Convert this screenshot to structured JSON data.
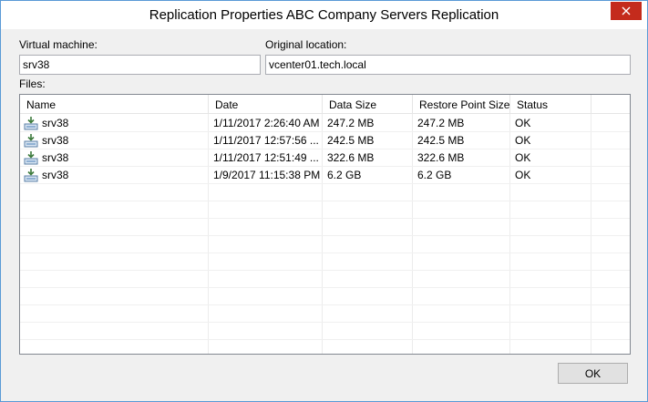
{
  "window": {
    "title": "Replication Properties ABC Company Servers Replication",
    "close_icon": "close-icon"
  },
  "form": {
    "vm_label": "Virtual machine:",
    "vm_value": "srv38",
    "location_label": "Original location:",
    "location_value": "vcenter01.tech.local",
    "files_label": "Files:"
  },
  "files_table": {
    "columns": [
      "Name",
      "Date",
      "Data Size",
      "Restore Point Size",
      "Status"
    ],
    "rows": [
      {
        "icon": "vm-disk-icon",
        "name": "srv38",
        "date": "1/11/2017 2:26:40 AM",
        "data_size": "247.2 MB",
        "restore_size": "247.2 MB",
        "status": "OK"
      },
      {
        "icon": "vm-disk-icon",
        "name": "srv38",
        "date": "1/11/2017 12:57:56 ...",
        "data_size": "242.5 MB",
        "restore_size": "242.5 MB",
        "status": "OK"
      },
      {
        "icon": "vm-disk-icon",
        "name": "srv38",
        "date": "1/11/2017 12:51:49 ...",
        "data_size": "322.6 MB",
        "restore_size": "322.6 MB",
        "status": "OK"
      },
      {
        "icon": "vm-disk-icon",
        "name": "srv38",
        "date": "1/9/2017 11:15:38 PM",
        "data_size": "6.2 GB",
        "restore_size": "6.2 GB",
        "status": "OK"
      }
    ]
  },
  "buttons": {
    "ok_label": "OK"
  },
  "colors": {
    "close_button": "#c42b1c",
    "window_border": "#5a9ad6"
  }
}
